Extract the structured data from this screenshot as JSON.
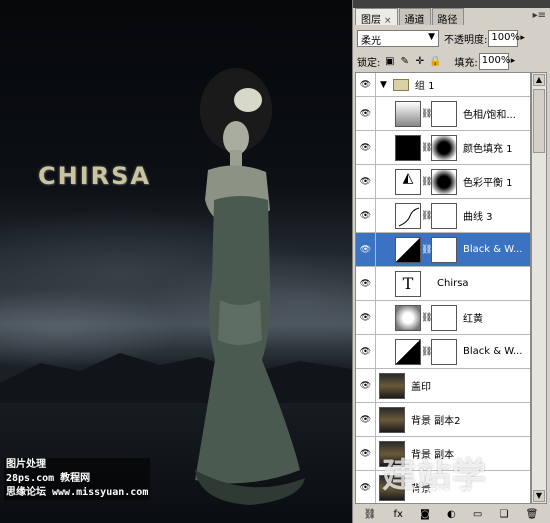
{
  "canvas": {
    "title_text": "CHIRSA"
  },
  "watermarks": {
    "left_line1": "图片处理",
    "left_line2": "28ps.com 教程网",
    "left_line3": "思缘论坛 www.missyuan.com",
    "right_main": "建站学",
    "right_sub": "jianzhan.com"
  },
  "panel": {
    "tabs": [
      {
        "label": "图层",
        "close": "×"
      },
      {
        "label": "通道"
      },
      {
        "label": "路径"
      }
    ],
    "menu_icon": "panel-menu-icon",
    "blend_mode": "柔光",
    "opacity_label": "不透明度:",
    "opacity_value": "100%",
    "lock_label": "锁定:",
    "fill_label": "填充:",
    "fill_value": "100%",
    "layers": [
      {
        "name": "组 1",
        "type": "group"
      },
      {
        "name": "色相/饱和...",
        "type": "adjustment"
      },
      {
        "name": "颜色填充 1",
        "type": "fill"
      },
      {
        "name": "色彩平衡 1",
        "type": "adjustment"
      },
      {
        "name": "曲线 3",
        "type": "adjustment"
      },
      {
        "name": "Black & W...",
        "type": "adjustment",
        "selected": true
      },
      {
        "name": "Chirsa",
        "type": "text",
        "thumb_glyph": "T"
      },
      {
        "name": "红黄",
        "type": "adjustment"
      },
      {
        "name": "Black & W...",
        "type": "adjustment"
      },
      {
        "name": "盖印",
        "type": "image"
      },
      {
        "name": "背景 副本2",
        "type": "image"
      },
      {
        "name": "背景 副本",
        "type": "image"
      },
      {
        "name": "背景",
        "type": "image"
      }
    ]
  },
  "colors": {
    "selection": "#3c72c2",
    "panel_bg": "#d4d0c8"
  }
}
